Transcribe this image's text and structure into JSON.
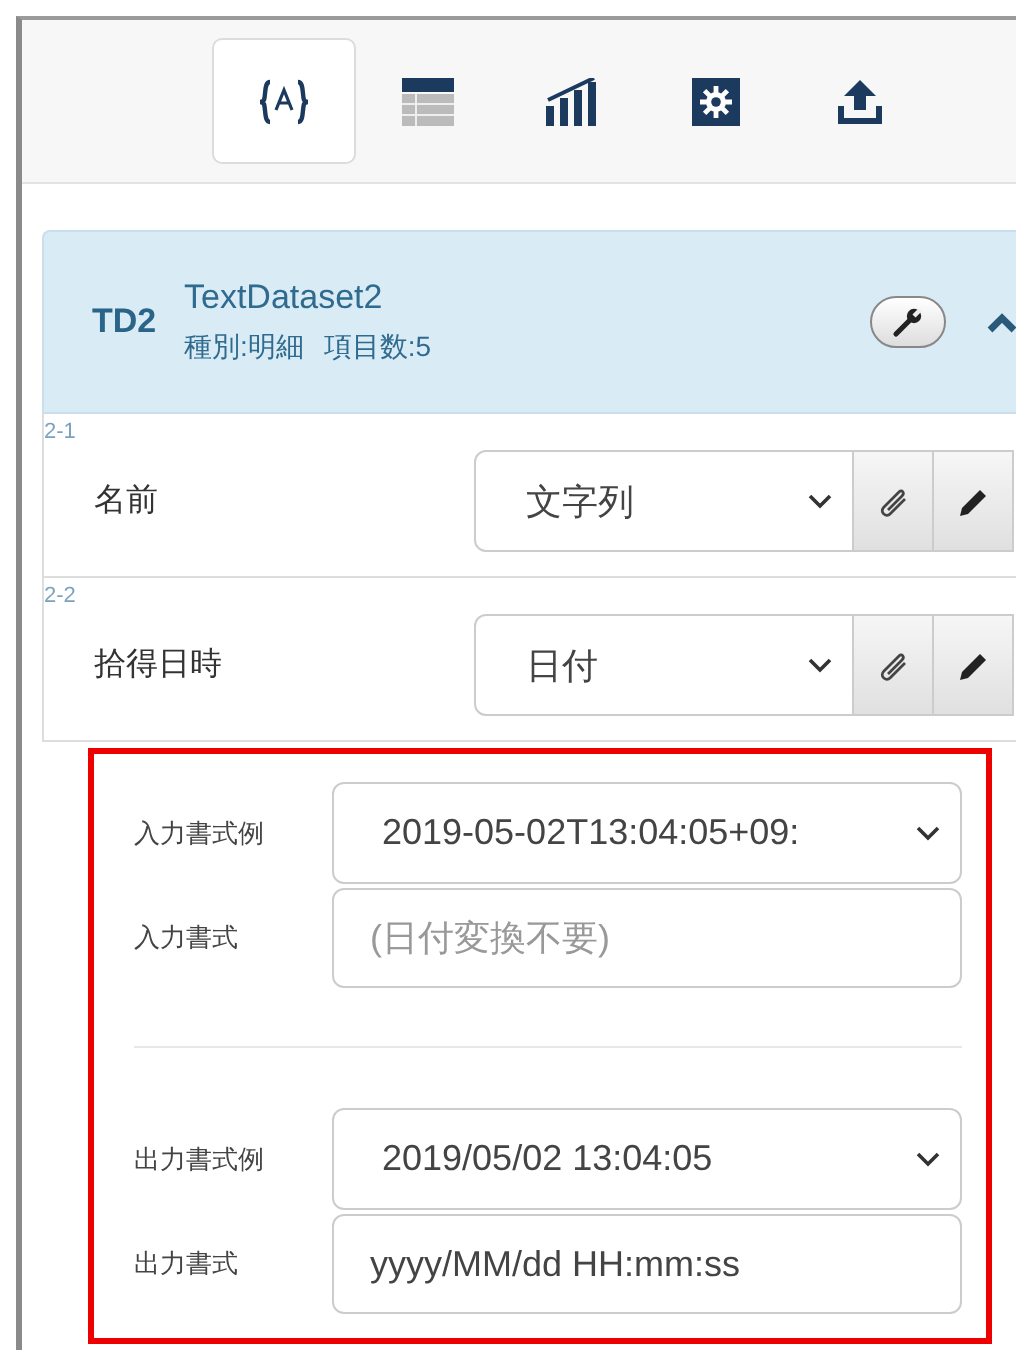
{
  "toolbar": {
    "tabs": [
      {
        "kind": "variable",
        "selected": true
      },
      {
        "kind": "table",
        "selected": false
      },
      {
        "kind": "chart",
        "selected": false
      },
      {
        "kind": "settings",
        "selected": false
      },
      {
        "kind": "upload",
        "selected": false
      }
    ]
  },
  "dataset": {
    "code": "TD2",
    "name": "TextDataset2",
    "type_label": "種別:明細",
    "count_label": "項目数:5",
    "expanded": true,
    "fields": [
      {
        "index": "2-1",
        "label": "名前",
        "type": "文字列"
      },
      {
        "index": "2-2",
        "label": "拾得日時",
        "type": "日付"
      }
    ]
  },
  "date_format": {
    "highlighted": true,
    "groups": [
      {
        "example_label": "入力書式例",
        "example": "2019-05-02T13:04:05+09:",
        "format_label": "入力書式",
        "placeholder": "(日付変換不要)"
      },
      {
        "example_label": "出力書式例",
        "example": "2019/05/02 13:04:05",
        "format_label": "出力書式",
        "value": "yyyy/MM/dd HH:mm:ss"
      }
    ]
  }
}
